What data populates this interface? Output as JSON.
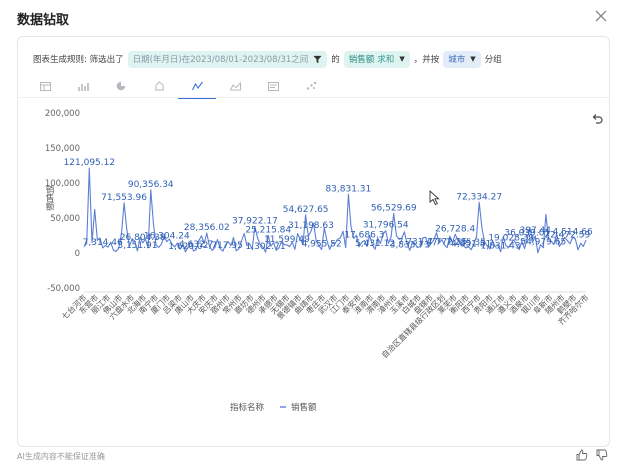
{
  "dialog": {
    "title": "数据钻取"
  },
  "rule": {
    "prefix": "图表生成规则: 筛选出了",
    "filter_label": "日期(年月日)在2023/08/01-2023/08/31之间",
    "of_text": "的",
    "measure_label": "销售额",
    "measure_agg": "求和",
    "group_text": "，并按",
    "dimension_label": "城市",
    "suffix": "分组"
  },
  "tabs": [
    {
      "icon": "table-icon",
      "active": false
    },
    {
      "icon": "bar-chart-icon",
      "active": false
    },
    {
      "icon": "pie-chart-icon",
      "active": false
    },
    {
      "icon": "map-icon",
      "active": false
    },
    {
      "icon": "line-chart-icon",
      "active": true
    },
    {
      "icon": "area-chart-icon",
      "active": false
    },
    {
      "icon": "card-icon",
      "active": false
    },
    {
      "icon": "scatter-icon",
      "active": false
    }
  ],
  "footer": {
    "note": "AI生成内容不能保证准确"
  },
  "colors": {
    "line": "#5b7fd6",
    "accent": "#3b74d6",
    "filter_chip": "#dff3f1",
    "group_chip": "#e3ecf9"
  },
  "chart_data": {
    "type": "line",
    "ylabel": "销售额",
    "ylim": [
      -50000,
      200000
    ],
    "yticks": [
      -50000,
      0,
      50000,
      100000,
      150000,
      200000
    ],
    "ytick_labels": [
      "-50,000",
      "0",
      "50,000",
      "100,000",
      "150,000",
      "200,000"
    ],
    "grid": false,
    "legend_title": "指标名称",
    "legend_position": "bottom",
    "series": [
      {
        "name": "销售额",
        "values": [
          9200,
          13400,
          121095,
          14800,
          62100,
          18200,
          21300,
          7315,
          10800,
          8400,
          15200,
          4100,
          2200,
          6800,
          26800,
          71554,
          34900,
          9600,
          20200,
          16700,
          3150,
          22100,
          14600,
          19800,
          7300,
          90356,
          42100,
          11200,
          8200,
          12700,
          23600,
          16304,
          19900,
          12400,
          8800,
          14200,
          5600,
          11900,
          1620,
          8300,
          15800,
          2900,
          4632,
          17700,
          24500,
          13800,
          28356,
          9400,
          3900,
          7600,
          19100,
          6300,
          2717,
          11400,
          16200,
          10700,
          22100,
          3100,
          6200,
          17200,
          27900,
          10600,
          13100,
          5700,
          37922,
          21400,
          11500,
          8900,
          1303,
          25216,
          9900,
          14700,
          3800,
          7100,
          16500,
          11900,
          11599,
          9200,
          15600,
          5300,
          27800,
          19400,
          12300,
          54628,
          23900,
          31198,
          42300,
          16800,
          10500,
          4955,
          36100,
          17100,
          5200,
          14000,
          13500,
          19700,
          21600,
          31200,
          7900,
          83831,
          37800,
          20900,
          25300,
          8800,
          15300,
          17686,
          9300,
          24800,
          11300,
          5431,
          21100,
          13700,
          26900,
          31797,
          13900,
          23200,
          56530,
          24800,
          19600,
          21300,
          30100,
          13600,
          3833,
          15700,
          13100,
          7731,
          9700,
          21800,
          22400,
          8500,
          13400,
          18600,
          28900,
          14300,
          19200,
          11700,
          7772,
          24100,
          14800,
          26728,
          18700,
          12900,
          10700,
          7235,
          8700,
          4851,
          12900,
          23700,
          72334,
          36100,
          16100,
          10500,
          5900,
          17400,
          9100,
          11800,
          1831,
          22700,
          10600,
          8200,
          13900,
          19028,
          11100,
          4800,
          16700,
          6400,
          20900,
          36039,
          15100,
          24300,
          397,
          11900,
          7600,
          54980,
          19300,
          16500,
          12300,
          27700,
          9300,
          14800,
          22300,
          17900,
          13200,
          22473,
          20100,
          4515,
          13800,
          9400,
          18300
        ],
        "labels": [
          {
            "i": 2,
            "text": "121,095.12"
          },
          {
            "i": 7,
            "text": "7,314.46"
          },
          {
            "i": 15,
            "text": "71,553.96"
          },
          {
            "i": 20,
            "text": "3,151.91"
          },
          {
            "i": 22,
            "text": "26,804.38"
          },
          {
            "i": 25,
            "text": "90,356.34"
          },
          {
            "i": 31,
            "text": "16,304.24"
          },
          {
            "i": 38,
            "text": "1,620.0"
          },
          {
            "i": 42,
            "text": "4,632.7"
          },
          {
            "i": 46,
            "text": "28,356.02"
          },
          {
            "i": 52,
            "text": "2,717.95"
          },
          {
            "i": 64,
            "text": "37,922.17"
          },
          {
            "i": 68,
            "text": "1,302.71"
          },
          {
            "i": 69,
            "text": "25,215.84"
          },
          {
            "i": 76,
            "text": "11,599.49"
          },
          {
            "i": 83,
            "text": "54,627.65"
          },
          {
            "i": 85,
            "text": "31,198.63"
          },
          {
            "i": 89,
            "text": "4,955.52"
          },
          {
            "i": 99,
            "text": "83,831.31"
          },
          {
            "i": 105,
            "text": "17,686.3"
          },
          {
            "i": 109,
            "text": "5,431.12"
          },
          {
            "i": 113,
            "text": "31,796.54"
          },
          {
            "i": 116,
            "text": "56,529.69"
          },
          {
            "i": 122,
            "text": "3,833.73"
          },
          {
            "i": 125,
            "text": "7,731.47"
          },
          {
            "i": 136,
            "text": "7,772.35"
          },
          {
            "i": 139,
            "text": "26,728.4"
          },
          {
            "i": 143,
            "text": "7,235.35"
          },
          {
            "i": 145,
            "text": "4,851.81"
          },
          {
            "i": 148,
            "text": "72,334.27"
          },
          {
            "i": 156,
            "text": "1,831.43"
          },
          {
            "i": 160,
            "text": "19,028.39"
          },
          {
            "i": 166,
            "text": "36,039.01"
          },
          {
            "i": 169,
            "text": "397.44"
          },
          {
            "i": 172,
            "text": "54,979.65"
          },
          {
            "i": 181,
            "text": "22,472.59"
          },
          {
            "i": 183,
            "text": "4,514.66"
          }
        ]
      }
    ],
    "xtick_labels": [
      "七台河市",
      "东营市",
      "丽江市",
      "佛山市",
      "六盘水市",
      "北海市",
      "南宁市",
      "厦门市",
      "吕梁市",
      "唐山市",
      "大庆市",
      "安庆市",
      "宿州市",
      "常州市",
      "廊坊市",
      "德州市",
      "承德市",
      "无锡市",
      "景德镇市",
      "曲靖市",
      "枣庄市",
      "武汉市",
      "江门市",
      "泰安市",
      "淮南市",
      "渭南市",
      "漳州市",
      "玉溪市",
      "白城市",
      "盘锦市",
      "自治区直辖县级行政区划",
      "莱芜市",
      "衡阳市",
      "西宁市",
      "贵阳市",
      "通辽市",
      "遵义市",
      "酒泉市",
      "银川市",
      "阜新市",
      "随州市",
      "鹤壁市",
      "齐齐哈尔市"
    ]
  }
}
